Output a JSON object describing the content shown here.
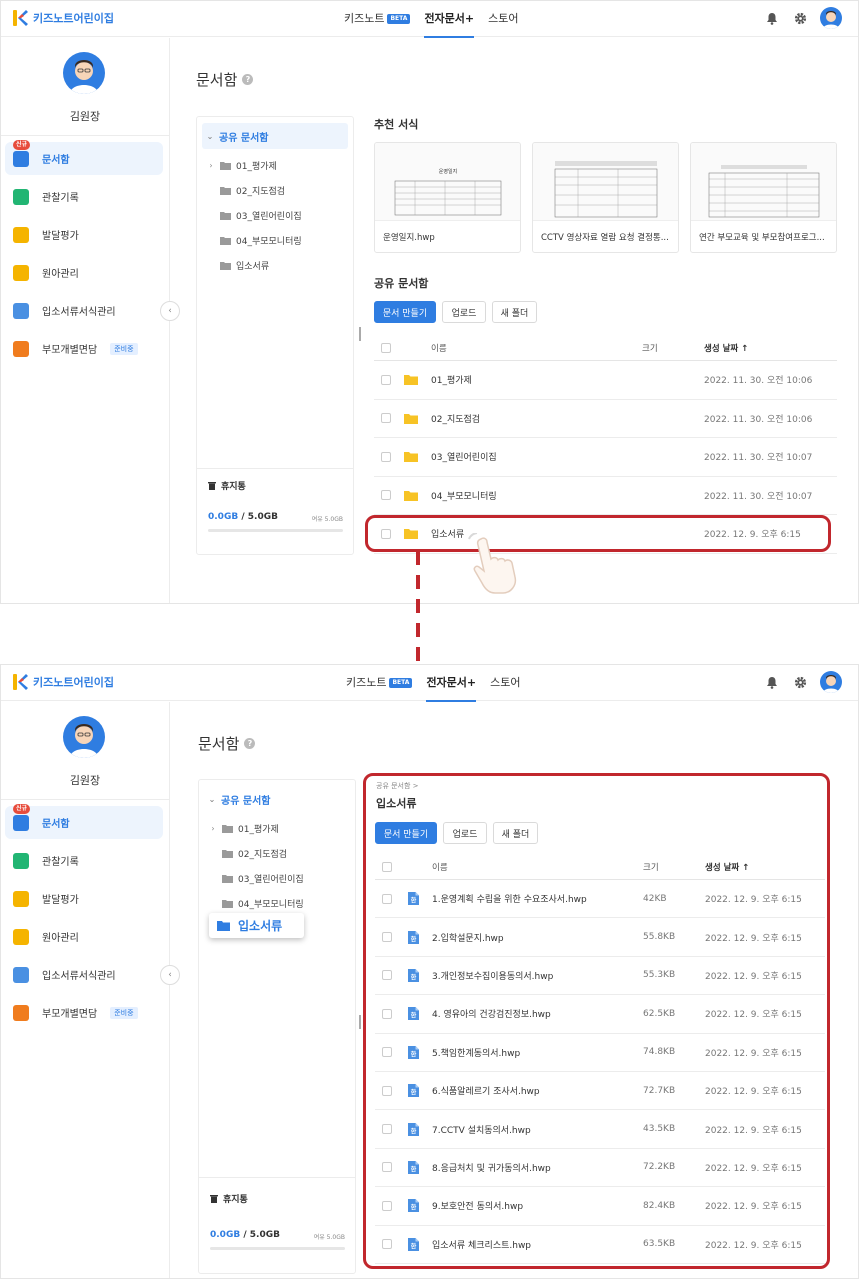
{
  "app": {
    "logo_text": "키즈노트어린이집",
    "nav": [
      {
        "label": "키즈노트",
        "badge": "BETA"
      },
      {
        "label": "전자문서+"
      },
      {
        "label": "스토어"
      }
    ],
    "user_name": "김원장"
  },
  "sidebar": {
    "items": [
      {
        "label": "문서함",
        "badge": "신규",
        "icon": "document-box-icon",
        "color": "#2f7de1"
      },
      {
        "label": "관찰기록",
        "icon": "observation-icon",
        "color": "#22b573"
      },
      {
        "label": "발달평가",
        "icon": "development-chart-icon",
        "color": "#f5b400"
      },
      {
        "label": "원아관리",
        "icon": "child-management-icon",
        "color": "#f5b400"
      },
      {
        "label": "입소서류서식관리",
        "icon": "admission-form-icon",
        "color": "#4a90e2"
      },
      {
        "label": "부모개별면담",
        "badge": "준비중",
        "icon": "parent-meeting-icon",
        "color": "#f07c1e"
      }
    ]
  },
  "page": {
    "title": "문서함"
  },
  "tree": {
    "root": "공유 문서함",
    "items": [
      "01_평가제",
      "02_지도점검",
      "03_열린어린이집",
      "04_부모모니터링",
      "입소서류"
    ],
    "trash_label": "휴지통",
    "quota_used": "0.0GB",
    "quota_total": "/ 5.0GB",
    "quota_remaining": "여유 5.0GB",
    "quota_fraction": 0.0
  },
  "recommended": {
    "title": "추천 서식",
    "cards": [
      {
        "name": "운영일지.hwp",
        "thumb_title": "운영일지"
      },
      {
        "name": "CCTV 영상자료 열람 요청 결정통...",
        "thumb_title": "CCTV 영상정보 열람 요청 결정 통지서"
      },
      {
        "name": "연간 부모교육 및 부모참여프로그...",
        "thumb_title": "연간 부모교육 및 부모참여프로그램 계획안"
      }
    ]
  },
  "shared": {
    "title": "공유 문서함",
    "buttons": {
      "create": "문서 만들기",
      "upload": "업로드",
      "new_folder": "새 폴더"
    },
    "columns": {
      "name": "이름",
      "size": "크기",
      "date": "생성 날짜 ↑"
    },
    "rows": [
      {
        "name": "01_평가제",
        "size": "",
        "date": "2022. 11. 30. 오전 10:06"
      },
      {
        "name": "02_지도점검",
        "size": "",
        "date": "2022. 11. 30. 오전 10:06"
      },
      {
        "name": "03_열린어린이집",
        "size": "",
        "date": "2022. 11. 30. 오전 10:07"
      },
      {
        "name": "04_부모모니터링",
        "size": "",
        "date": "2022. 11. 30. 오전 10:07"
      },
      {
        "name": "입소서류",
        "size": "",
        "date": "2022. 12. 9. 오후 6:15"
      }
    ]
  },
  "folder_view": {
    "breadcrumb": "공유 문서함  >",
    "title": "입소서류",
    "drag_label": "입소서류",
    "rows": [
      {
        "name": "1.운영계획 수립을 위한 수요조사서.hwp",
        "size": "42KB",
        "date": "2022. 12. 9. 오후 6:15"
      },
      {
        "name": "2.입학설문지.hwp",
        "size": "55.8KB",
        "date": "2022. 12. 9. 오후 6:15"
      },
      {
        "name": "3.개인정보수집이용동의서.hwp",
        "size": "55.3KB",
        "date": "2022. 12. 9. 오후 6:15"
      },
      {
        "name": "4. 영유아의 건강검진정보.hwp",
        "size": "62.5KB",
        "date": "2022. 12. 9. 오후 6:15"
      },
      {
        "name": "5.책임한계동의서.hwp",
        "size": "74.8KB",
        "date": "2022. 12. 9. 오후 6:15"
      },
      {
        "name": "6.식품알레르기 조사서.hwp",
        "size": "72.7KB",
        "date": "2022. 12. 9. 오후 6:15"
      },
      {
        "name": "7.CCTV 설치동의서.hwp",
        "size": "43.5KB",
        "date": "2022. 12. 9. 오후 6:15"
      },
      {
        "name": "8.응급처치 및 귀가동의서.hwp",
        "size": "72.2KB",
        "date": "2022. 12. 9. 오후 6:15"
      },
      {
        "name": "9.보호안전 동의서.hwp",
        "size": "82.4KB",
        "date": "2022. 12. 9. 오후 6:15"
      },
      {
        "name": "입소서류 체크리스트.hwp",
        "size": "63.5KB",
        "date": "2022. 12. 9. 오후 6:15"
      }
    ]
  },
  "colors": {
    "accent": "#2f7de1",
    "highlight": "#c1272d",
    "folder": "#f7c325"
  }
}
